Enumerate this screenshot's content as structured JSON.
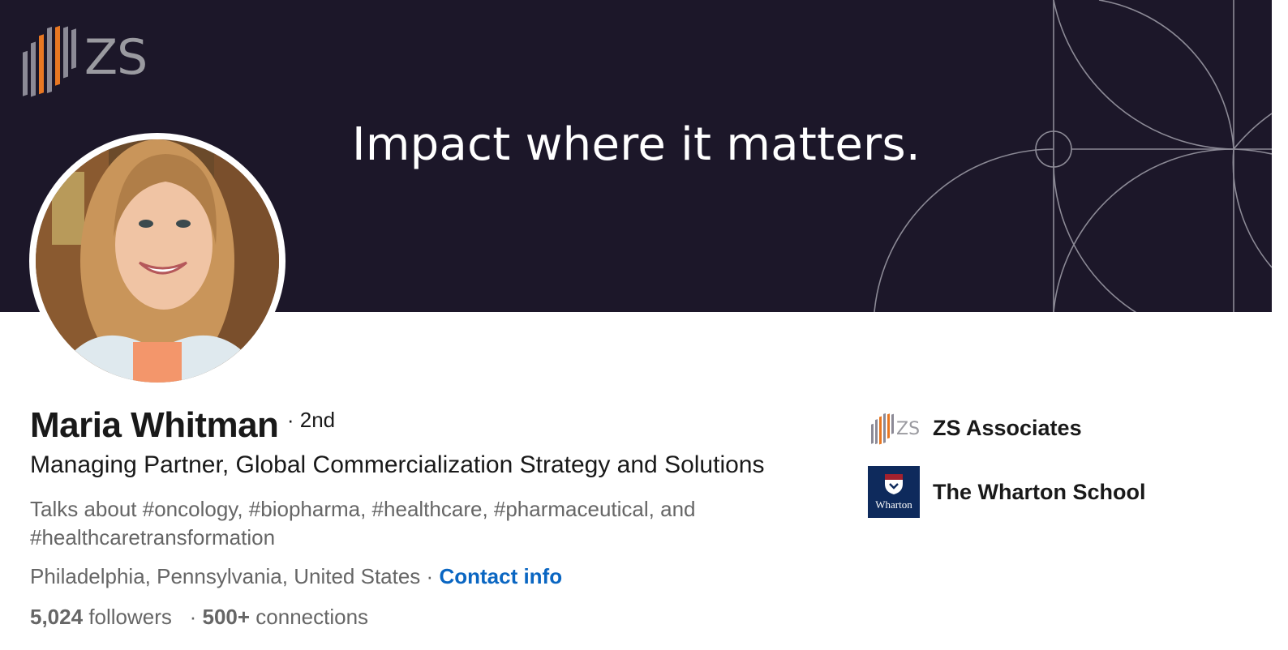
{
  "banner": {
    "logo_text": "ZS",
    "tagline": "Impact where it matters.",
    "colors": {
      "background": "#1c1729",
      "accent": "#e87722",
      "line": "#8c8a96"
    }
  },
  "profile": {
    "name": "Maria Whitman",
    "degree": "· 2nd",
    "headline": "Managing Partner, Global Commercialization Strategy and Solutions",
    "talks_about": "Talks about #oncology, #biopharma, #healthcare, #pharmaceutical, and #healthcaretransformation",
    "location": "Philadelphia, Pennsylvania, United States",
    "location_separator": "·",
    "contact_label": "Contact info",
    "followers_count": "5,024",
    "followers_label": "followers",
    "stats_separator": "·",
    "connections_count": "500+",
    "connections_label": "connections",
    "link_color": "#0a66c2"
  },
  "organizations": [
    {
      "name": "ZS Associates",
      "logo_text": "ZS"
    },
    {
      "name": "The Wharton School",
      "logo_text": "Wharton"
    }
  ]
}
